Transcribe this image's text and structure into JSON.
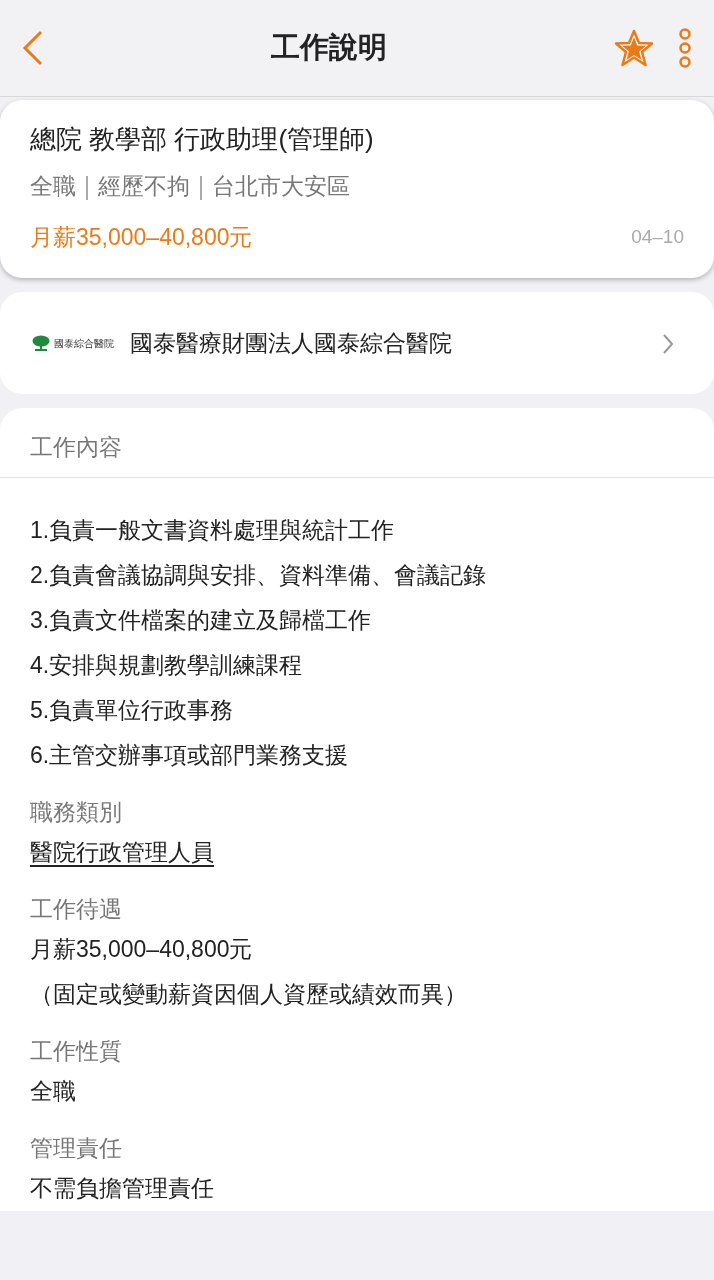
{
  "header": {
    "title": "工作說明",
    "favorited": true
  },
  "job": {
    "title": "總院 教學部 行政助理(管理師)",
    "meta": [
      "全職",
      "經歷不拘",
      "台北市大安區"
    ],
    "salary": "月薪35,000–40,800元",
    "date": "04–10"
  },
  "company": {
    "logo_text": "國泰綜合醫院",
    "name": "國泰醫療財團法人國泰綜合醫院"
  },
  "details": {
    "title": "工作內容",
    "description": [
      "1.負責一般文書資料處理與統計工作",
      "2.負責會議協調與安排、資料準備、會議記錄",
      "3.負責文件檔案的建立及歸檔工作",
      "4.安排與規劃教學訓練課程",
      "5.負責單位行政事務",
      "6.主管交辦事項或部門業務支援"
    ],
    "fields": [
      {
        "label": "職務類別",
        "kind": "link",
        "values": [
          "醫院行政管理人員"
        ]
      },
      {
        "label": "工作待遇",
        "kind": "text",
        "values": [
          "月薪35,000–40,800元",
          "（固定或變動薪資因個人資歷或績效而異）"
        ]
      },
      {
        "label": "工作性質",
        "kind": "text",
        "values": [
          "全職"
        ]
      },
      {
        "label": "管理責任",
        "kind": "text",
        "values": [
          "不需負擔管理責任"
        ]
      }
    ]
  }
}
